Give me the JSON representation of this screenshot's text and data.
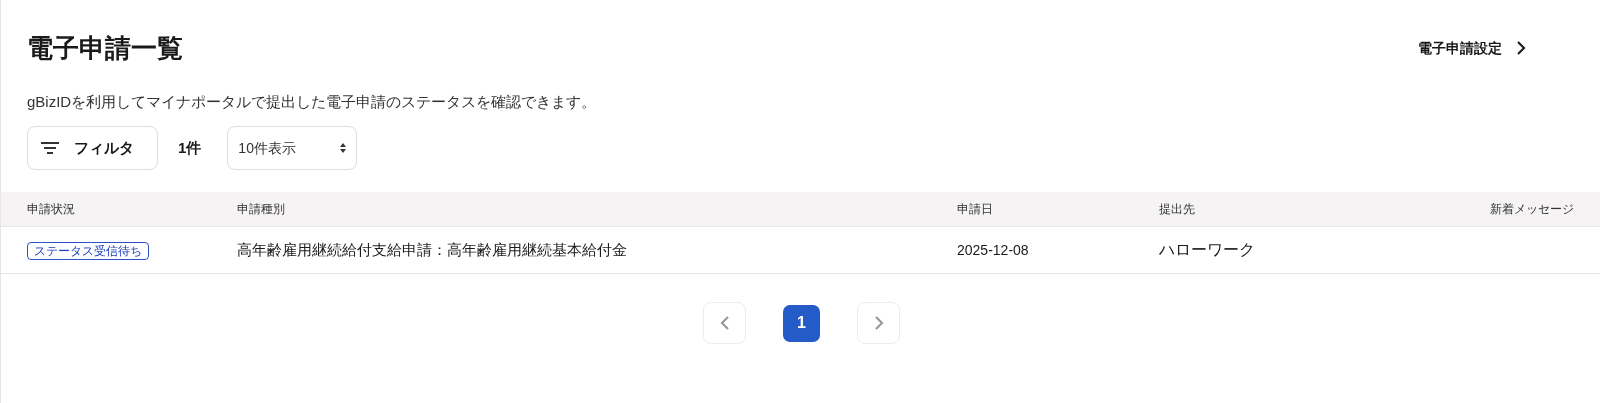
{
  "title": "電子申請一覧",
  "settings_link": "電子申請設定",
  "description": "gBizIDを利用してマイナポータルで提出した電子申請のステータスを確認できます。",
  "toolbar": {
    "filter_button": "フィルタ",
    "count": "1件",
    "page_size": "10件表示"
  },
  "table": {
    "columns": [
      "申請状況",
      "申請種別",
      "申請日",
      "提出先",
      "新着メッセージ"
    ],
    "rows": [
      {
        "status": "ステータス受信待ち",
        "type": "高年齢雇用継続給付支給申請：高年齢雇用継続基本給付金",
        "date": "2025-12-08",
        "destination": "ハローワーク"
      }
    ]
  },
  "pagination": {
    "prev_disabled": true,
    "next_disabled": true,
    "pages": [
      {
        "label": "1",
        "selected": true
      }
    ]
  }
}
